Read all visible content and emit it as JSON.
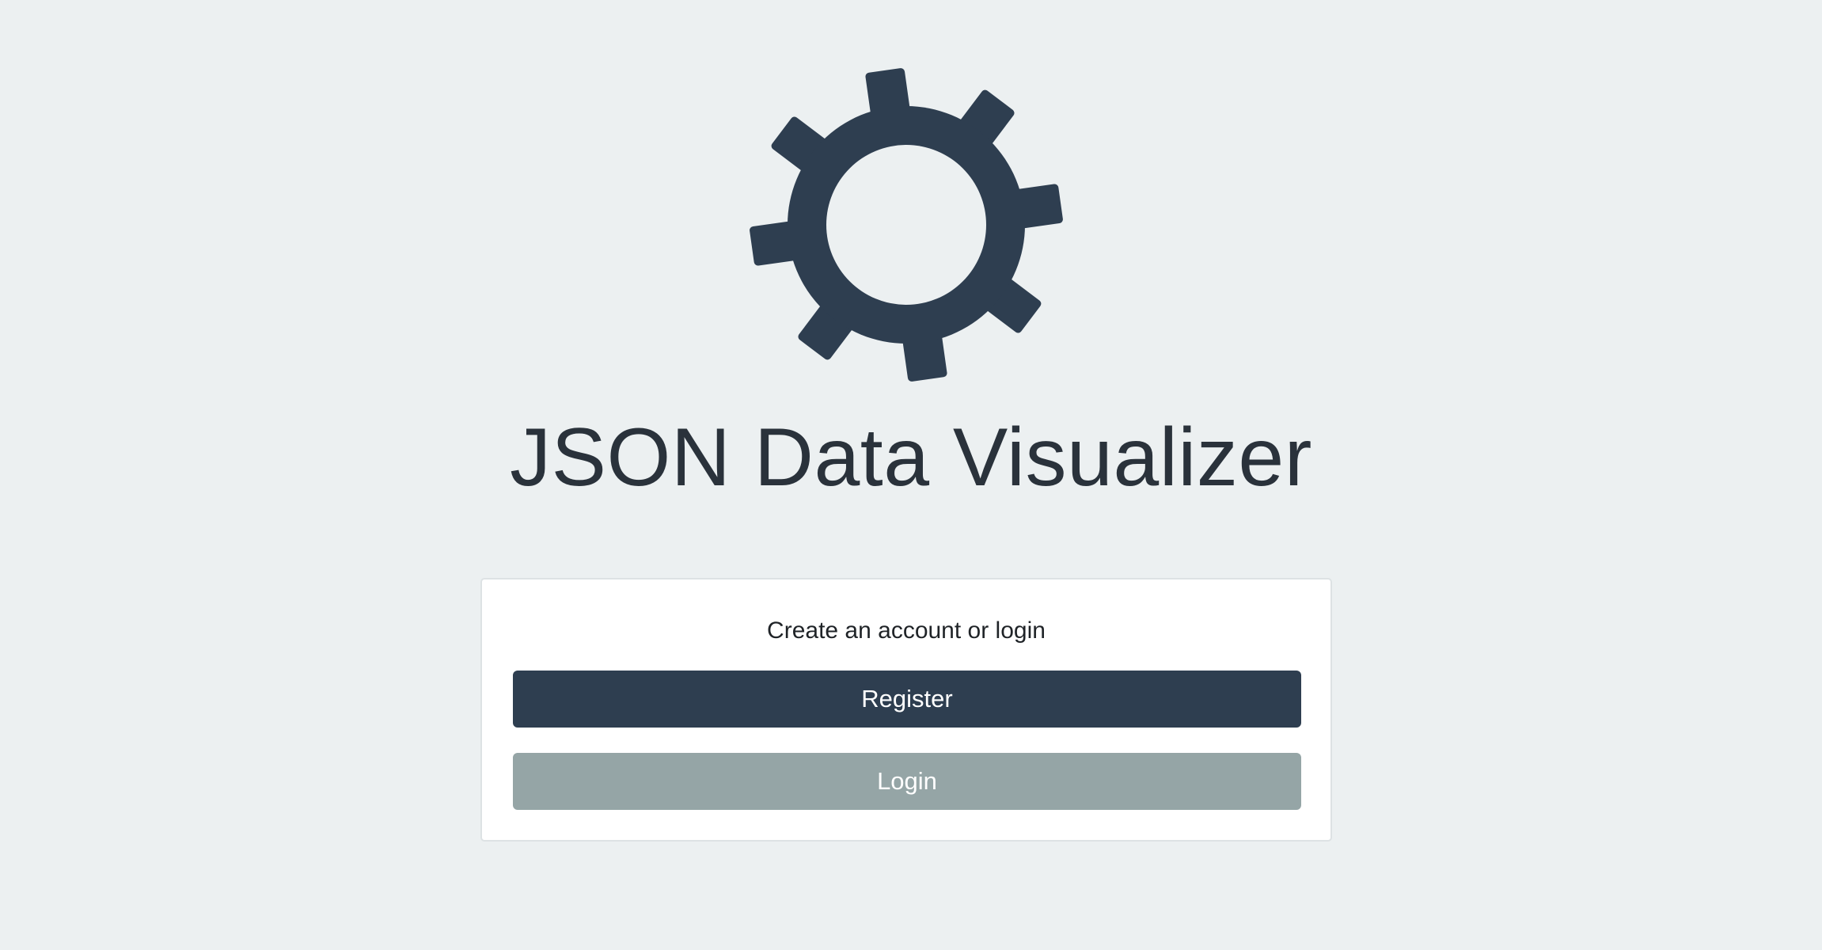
{
  "app": {
    "logo_icon": "gear-icon",
    "title": "JSON Data Visualizer"
  },
  "auth_card": {
    "prompt": "Create an account or login",
    "register_label": "Register",
    "login_label": "Login"
  },
  "colors": {
    "background": "#ecf0f1",
    "primary": "#2e3e50",
    "secondary": "#95a5a6",
    "card": "#ffffff"
  }
}
